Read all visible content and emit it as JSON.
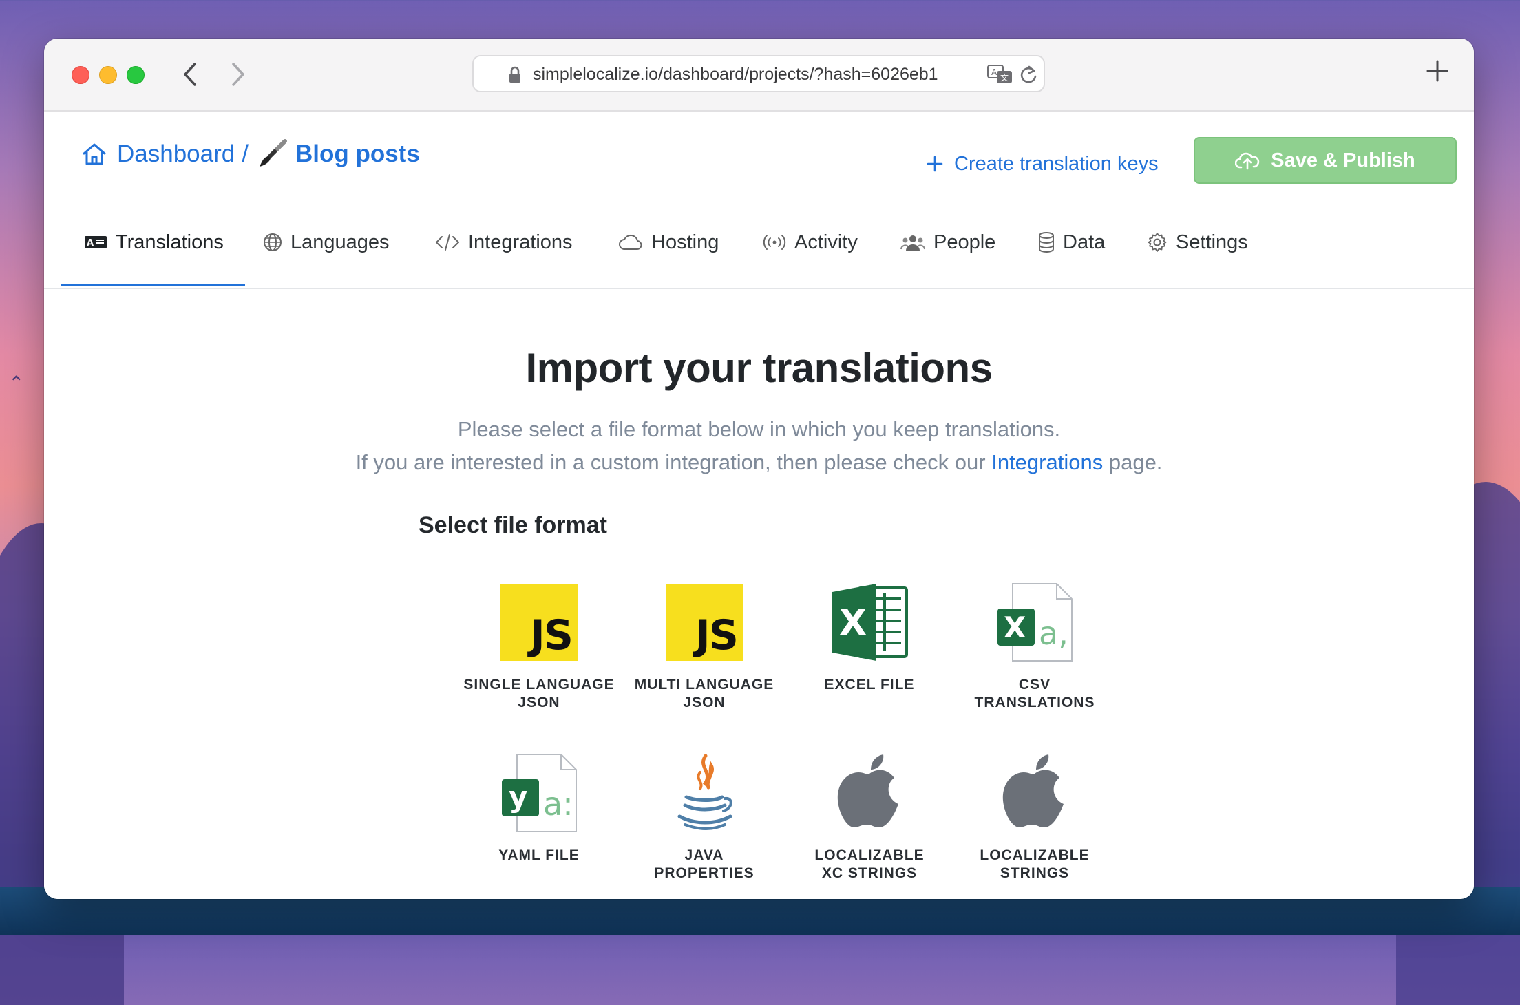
{
  "browser": {
    "url": "simplelocalize.io/dashboard/projects/?hash=6026eb1"
  },
  "breadcrumb": {
    "dashboard": "Dashboard",
    "separator": "/",
    "project": "Blog posts"
  },
  "actions": {
    "create_keys": "Create translation keys",
    "save_publish": "Save & Publish"
  },
  "tabs": [
    {
      "label": "Translations",
      "icon": "translations-icon",
      "active": true
    },
    {
      "label": "Languages",
      "icon": "globe-icon"
    },
    {
      "label": "Integrations",
      "icon": "code-icon"
    },
    {
      "label": "Hosting",
      "icon": "cloud-icon"
    },
    {
      "label": "Activity",
      "icon": "broadcast-icon"
    },
    {
      "label": "People",
      "icon": "people-icon"
    },
    {
      "label": "Data",
      "icon": "database-icon"
    },
    {
      "label": "Settings",
      "icon": "gear-icon"
    }
  ],
  "main": {
    "heading": "Import your translations",
    "subtitle_line1": "Please select a file format below in which you keep translations.",
    "subtitle_line2_before": "If you are interested in a custom integration, then please check our",
    "subtitle_line2_link": "Integrations",
    "subtitle_line2_after": "page.",
    "section_title": "Select file format"
  },
  "formats": [
    {
      "line1": "SINGLE LANGUAGE",
      "line2": "JSON",
      "icon": "js-icon"
    },
    {
      "line1": "MULTI LANGUAGE",
      "line2": "JSON",
      "icon": "js-icon"
    },
    {
      "line1": "EXCEL FILE",
      "line2": "",
      "icon": "excel-icon"
    },
    {
      "line1": "CSV",
      "line2": "TRANSLATIONS",
      "icon": "csv-file-icon"
    },
    {
      "line1": "YAML FILE",
      "line2": "",
      "icon": "yaml-file-icon"
    },
    {
      "line1": "JAVA",
      "line2": "PROPERTIES",
      "icon": "java-icon"
    },
    {
      "line1": "LOCALIZABLE",
      "line2": "XC STRINGS",
      "icon": "apple-icon"
    },
    {
      "line1": "LOCALIZABLE",
      "line2": "STRINGS",
      "icon": "apple-icon"
    }
  ],
  "colors": {
    "accent": "#2272d9",
    "save_button": "#8fd08f",
    "js_yellow": "#f7df1e",
    "excel_green": "#1d6f42"
  }
}
